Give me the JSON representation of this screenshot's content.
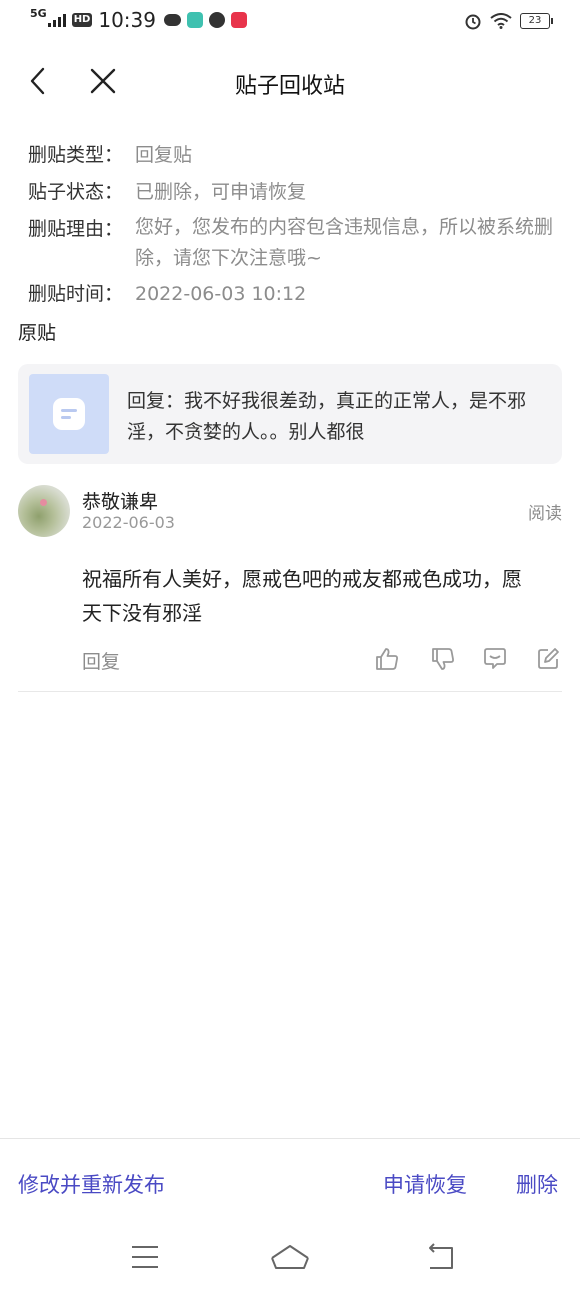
{
  "status_bar": {
    "network": "5G",
    "hd": "HD",
    "time": "10:39",
    "battery": "23"
  },
  "nav": {
    "title": "贴子回收站"
  },
  "info": {
    "type_label": "删贴类型：",
    "type_value": "回复贴",
    "status_label": "贴子状态：",
    "status_value": "已删除，可申请恢复",
    "reason_label": "删贴理由：",
    "reason_value": "您好，您发布的内容包含违规信息，所以被系统删除，请您下次注意哦~",
    "time_label": "删贴时间：",
    "time_value": "2022-06-03 10:12"
  },
  "original": {
    "section_title": "原贴",
    "text": "回复：我不好我很差劲，真正的正常人，是不邪淫，不贪婪的人。。别人都很"
  },
  "comment": {
    "username": "恭敬谦卑",
    "date": "2022-06-03",
    "read_label": "阅读",
    "text": " 祝福所有人美好，愿戒色吧的戒友都戒色成功，愿天下没有邪淫",
    "reply_label": "回复"
  },
  "bottom": {
    "edit_label": "修改并重新发布",
    "restore_label": "申请恢复",
    "delete_label": "删除"
  },
  "colors": {
    "accent": "#4a4ac4",
    "muted": "#8c8c8c",
    "card_bg": "#f4f4f6",
    "thumb_bg": "#cfdcf8"
  }
}
